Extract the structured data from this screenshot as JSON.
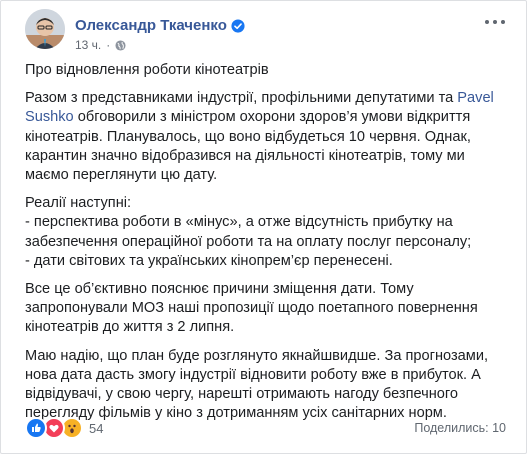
{
  "post": {
    "author": "Олександр Ткаченко",
    "time": "13 ч.",
    "dot": "·",
    "paragraphs": [
      {
        "parts": [
          "Про відновлення роботи кінотеатрів"
        ]
      },
      {
        "before": "Разом з представниками індустрії, профільними депутатими та ",
        "mention": "Pavel Sushko",
        "after": " обговорили з міністром охорони здоров’я умови відкриття кінотеатрів. Планувалось, що воно відбудеться 10 червня. Однак, карантин значно відобразився на діяльності кінотеатрів, тому ми маємо переглянути цю дату."
      },
      {
        "lines": [
          "Реалії наступні:",
          "- перспектива роботи в «мінус», а отже відсутність прибутку на забезпечення операційної роботи та на оплату послуг персоналу;",
          "- дати світових та українських кінопрем’єр перенесені."
        ]
      },
      {
        "parts": [
          "Все це об’єктивно пояснює причини зміщення дати. Тому запропонували МОЗ наші пропозиції щодо поетапного повернення кінотеатрів до життя з 2 липня."
        ]
      },
      {
        "parts": [
          "Маю надію, що план буде розглянуто якнайшвидше. За прогнозами, нова дата дасть змогу індустрії відновити роботу вже в прибуток. А відвідувачі, у свою чергу, нарешті отримають нагоду безпечного перегляду фільмів у кіно з дотриманням усіх санітарних норм."
        ]
      }
    ]
  },
  "footer": {
    "reactions_count": "54",
    "shares": "Поделились: 10"
  },
  "icons": {
    "verified": "verified-badge-icon",
    "privacy": "globe-icon",
    "more": "more-options-icon",
    "reactions": [
      "like-icon",
      "love-icon",
      "wow-icon"
    ]
  },
  "colors": {
    "link": "#385898",
    "text": "#1c1e21",
    "muted": "#606770",
    "like": "#1877f2",
    "love": "#f33e58",
    "wow": "#f7b125"
  }
}
